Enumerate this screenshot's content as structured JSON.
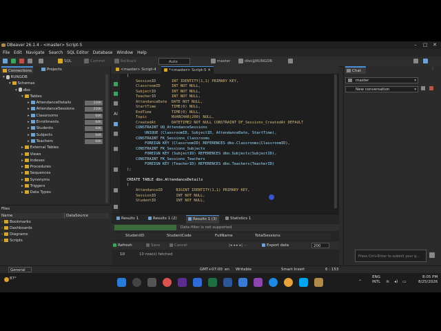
{
  "app": {
    "title": "DBeaver 26.1.4 - <master> Script-5",
    "icon": "dbeaver-icon"
  },
  "menu": [
    "File",
    "Edit",
    "Navigate",
    "Search",
    "SQL Editor",
    "Database",
    "Window",
    "Help"
  ],
  "toolbar": {
    "sql_label": "SQL",
    "commit_label": "Commit",
    "rollback_label": "Rollback",
    "mode_value": "Auto",
    "catalog_value": "master",
    "schema_value": "dbo@RUNGDB"
  },
  "left": {
    "tab_connections": "Connections",
    "tab_projects": "Projects",
    "tree": [
      {
        "label": "RUNGDB",
        "indent": 0,
        "icon": "db"
      },
      {
        "label": "Schemas",
        "indent": 1,
        "icon": "folder"
      },
      {
        "label": "dbo",
        "indent": 2,
        "icon": "db"
      },
      {
        "label": "Tables",
        "indent": 3,
        "icon": "folder"
      },
      {
        "label": "AttendanceDetails",
        "indent": 4,
        "icon": "table",
        "badge": "216K"
      },
      {
        "label": "AttendanceSessions",
        "indent": 4,
        "icon": "table",
        "badge": "216K"
      },
      {
        "label": "Classrooms",
        "indent": 4,
        "icon": "table",
        "badge": "64K"
      },
      {
        "label": "Enrollments",
        "indent": 4,
        "icon": "table",
        "badge": "64K"
      },
      {
        "label": "Students",
        "indent": 4,
        "icon": "table",
        "badge": "64K"
      },
      {
        "label": "Subjects",
        "indent": 4,
        "icon": "table",
        "badge": "64K"
      },
      {
        "label": "Teachers",
        "indent": 4,
        "icon": "table",
        "badge": "64K"
      },
      {
        "label": "External Tables",
        "indent": 3,
        "icon": "folder"
      },
      {
        "label": "Views",
        "indent": 3,
        "icon": "folder"
      },
      {
        "label": "Indexes",
        "indent": 3,
        "icon": "folder"
      },
      {
        "label": "Procedures",
        "indent": 3,
        "icon": "folder"
      },
      {
        "label": "Sequences",
        "indent": 3,
        "icon": "folder"
      },
      {
        "label": "Synonyms",
        "indent": 3,
        "icon": "folder"
      },
      {
        "label": "Triggers",
        "indent": 3,
        "icon": "folder"
      },
      {
        "label": "Data Types",
        "indent": 3,
        "icon": "folder"
      }
    ],
    "files_title": "Files",
    "files_col_name": "Name",
    "files_col_ds": "DataSource",
    "files": [
      "Bookmarks",
      "Dashboards",
      "Diagrams",
      "Scripts"
    ]
  },
  "editor": {
    "tabs": [
      "<master> Script-4",
      "*<master> Script-5"
    ],
    "code_lines": [
      "(",
      "    SessionID       INT IDENTITY(1,1) PRIMARY KEY,",
      "    ClassroomID     INT NOT NULL,",
      "    SubjectID       INT NOT NULL,",
      "    TeacherID       INT NOT NULL,",
      "    AttendanceDate  DATE NOT NULL,",
      "    StartTime       TIME(0) NULL,",
      "    EndTime         TIME(0) NULL,",
      "    Topic           NVARCHAR(200) NULL,",
      "    CreatedAt       DATETIME2 NOT NULL CONSTRAINT DF_Sessions_CreatedAt DEFAULT",
      "    CONSTRAINT UQ_AttendanceSessions",
      "        UNIQUE (ClassroomID, SubjectID, AttendanceDate, StartTime),",
      "    CONSTRAINT FK_Sessions_Classrooms",
      "        FOREIGN KEY (ClassroomID) REFERENCES dbo.Classrooms(ClassroomID),",
      "    CONSTRAINT FK_Sessions_Subjects",
      "        FOREIGN KEY (SubjectID) REFERENCES dbo.Subjects(SubjectID),",
      "    CONSTRAINT FK_Sessions_Teachers",
      "        FOREIGN KEY (TeacherID) REFERENCES dbo.Teachers(TeacherID)",
      ");",
      "",
      "CREATE TABLE dbo.AttendanceDetails",
      "(",
      "    AttendanceID      BIGINT IDENTITY(1,1) PRIMARY KEY,",
      "    SessionID         INT NOT NULL,",
      "    StudentID         INT NOT NULL,"
    ]
  },
  "results": {
    "tabs": [
      "Results 1",
      "Results 1 (2)",
      "Results 1 (3)",
      "Statistics 1"
    ],
    "filter_msg": "Data filter is not supported",
    "columns": [
      "StudentID",
      "StudentCode",
      "FullName",
      "TotalSessions"
    ],
    "refresh_label": "Refresh",
    "save_label": "Save",
    "cancel_label": "Cancel",
    "export_label": "Export data",
    "fetch_size": "200",
    "row_count": "10",
    "fetched_msg": "10 row(s) fetched"
  },
  "chat": {
    "title": "Chat",
    "connection_value": "master",
    "conversation_value": "New conversation",
    "input_placeholder": "Press Ctrl+Enter to submit your q..."
  },
  "status": {
    "left": "General",
    "tz": "GMT+07:00",
    "locale": "en",
    "mode": "Writable",
    "insert": "Smart Insert",
    "pos": "6 : 153"
  },
  "taskbar": {
    "weather_temp": "87°",
    "lang1": "ENG",
    "lang2": "INTL",
    "time": "8:05 PM",
    "date": "8/25/2026"
  }
}
